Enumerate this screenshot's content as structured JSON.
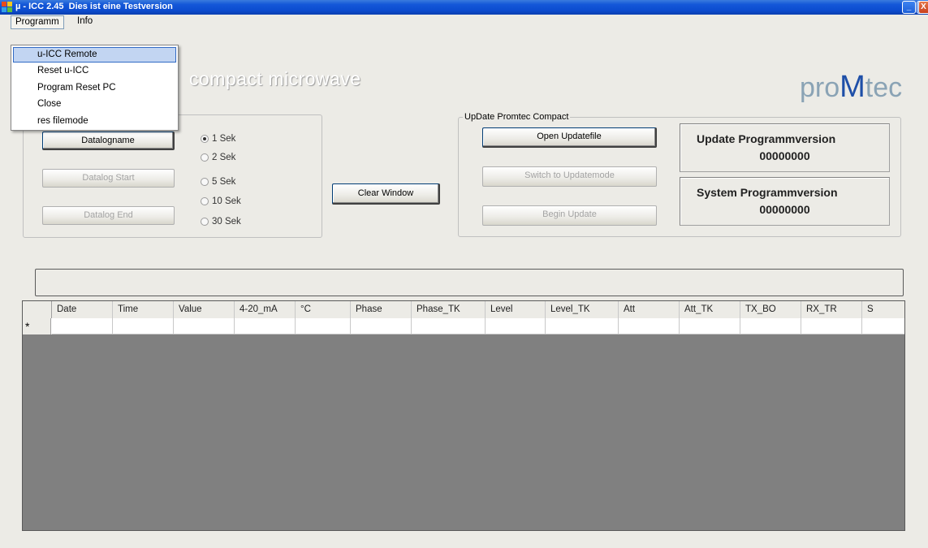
{
  "window": {
    "title": "µ - ICC 2.45  Dies ist eine Testversion",
    "buttons": {
      "minimize": "_",
      "restore": "❐",
      "close": "X"
    }
  },
  "menubar": {
    "items": [
      {
        "label": "Programm"
      },
      {
        "label": "Info"
      }
    ]
  },
  "dropdown": {
    "items": [
      {
        "label": "u-ICC Remote",
        "highlighted": true
      },
      {
        "label": "Reset u-ICC"
      },
      {
        "label": "Program Reset PC"
      },
      {
        "label": "Close"
      },
      {
        "label": "res filemode"
      }
    ]
  },
  "header": {
    "title": "compact microwave",
    "logo": {
      "prefix": "pro",
      "accent": "M",
      "suffix": "tec"
    }
  },
  "datalog": {
    "buttons": {
      "name": "Datalogname",
      "start": "Datalog Start",
      "end": "Datalog End"
    },
    "intervals": [
      "1 Sek",
      "2 Sek",
      "5 Sek",
      "10 Sek",
      "30 Sek"
    ],
    "selected_interval": "1 Sek"
  },
  "clear_button": "Clear Window",
  "update": {
    "group_label": "UpDate Promtec Compact",
    "buttons": {
      "open": "Open Updatefile",
      "switch": "Switch to Updatemode",
      "begin": "Begin Update"
    },
    "update_version": {
      "title": "Update Programmversion",
      "value": "00000000"
    },
    "system_version": {
      "title": "System Programmversion",
      "value": "00000000"
    }
  },
  "table": {
    "columns": [
      "Date",
      "Time",
      "Value",
      "4-20_mA",
      "°C",
      "Phase",
      "Phase_TK",
      "Level",
      "Level_TK",
      "Att",
      "Att_TK",
      "TX_BO",
      "RX_TR",
      "S"
    ],
    "new_row_marker": "*"
  },
  "colors": {
    "title_bar": "#0c4cd0",
    "window_bg": "#ecebe6",
    "grid_bg": "#808080",
    "menu_highlight": "#c2d5f2",
    "logo_accent": "#1e4fa8",
    "logo_text": "#8aa3b5"
  }
}
